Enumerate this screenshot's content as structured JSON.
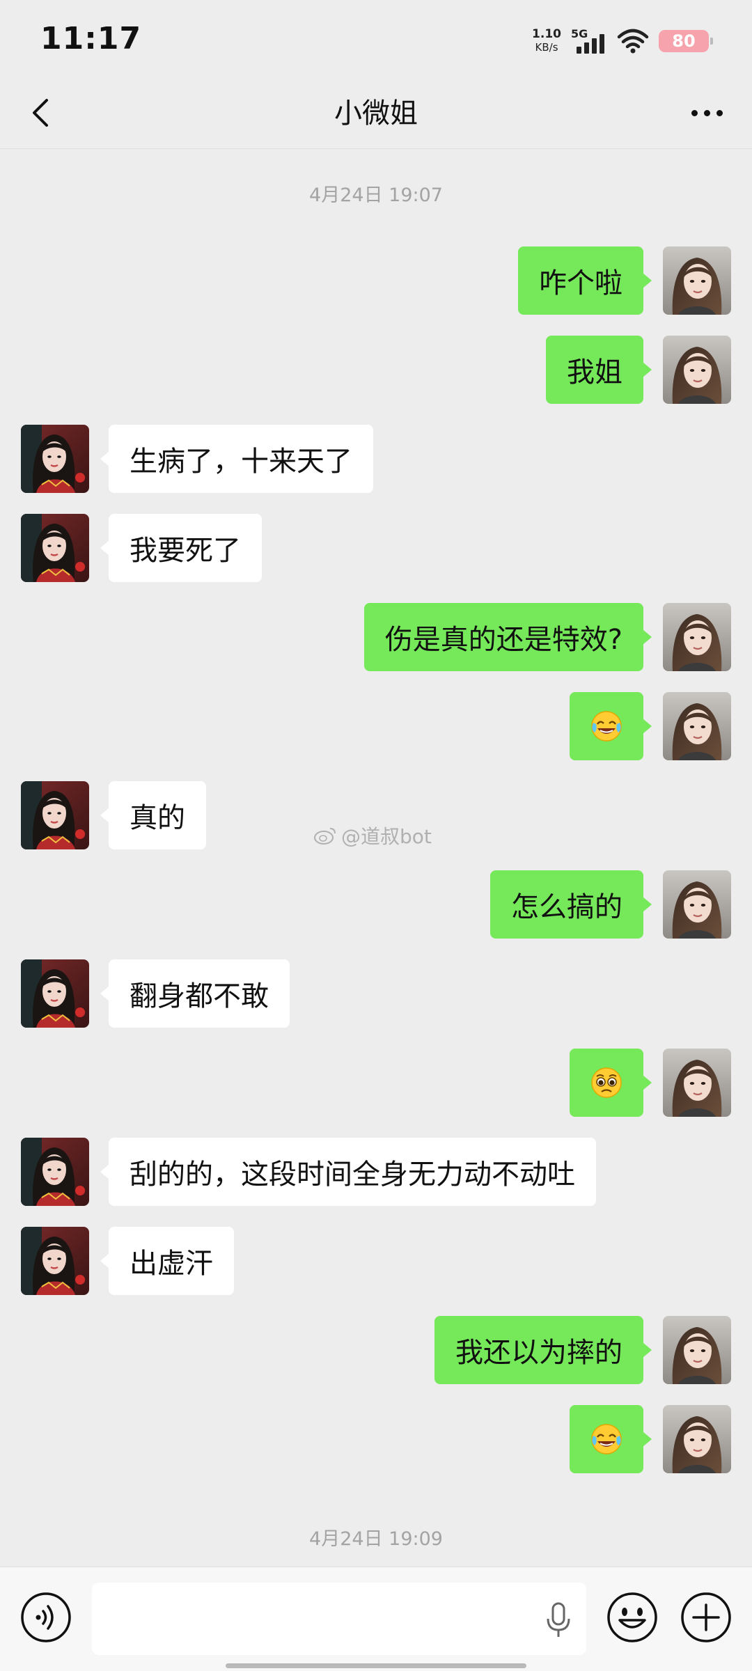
{
  "status_bar": {
    "time": "11:17",
    "net_speed_value": "1.10",
    "net_speed_unit": "KB/s",
    "network": "5G",
    "battery": "80"
  },
  "nav": {
    "title": "小微姐",
    "back_icon": "chevron-left-icon",
    "more_icon": "more-dots-icon"
  },
  "chat": {
    "timestamp_top": "4月24日 19:07",
    "timestamp_bottom": "4月24日 19:09",
    "messages": [
      {
        "from": "me",
        "text": "咋个啦"
      },
      {
        "from": "me",
        "text": "我姐"
      },
      {
        "from": "other",
        "text": "生病了，十来天了"
      },
      {
        "from": "other",
        "text": "我要死了"
      },
      {
        "from": "me",
        "text": "伤是真的还是特效?"
      },
      {
        "from": "me",
        "emoji": "laugh-cry-emoji"
      },
      {
        "from": "other",
        "text": "真的"
      },
      {
        "from": "me",
        "text": "怎么搞的"
      },
      {
        "from": "other",
        "text": "翻身都不敢"
      },
      {
        "from": "me",
        "emoji": "pleading-emoji"
      },
      {
        "from": "other",
        "text": "刮的的，这段时间全身无力动不动吐"
      },
      {
        "from": "other",
        "text": "出虚汗"
      },
      {
        "from": "me",
        "text": "我还以为摔的"
      },
      {
        "from": "me",
        "emoji": "laugh-cry-emoji"
      }
    ],
    "watermark": "@道叔bot"
  },
  "input_bar": {
    "voice_icon": "voice-icon",
    "mic_icon": "mic-icon",
    "emoji_icon": "smiley-icon",
    "plus_icon": "plus-icon"
  },
  "colors": {
    "background": "#ededed",
    "me_bubble": "#76e95a",
    "other_bubble": "#ffffff",
    "timestamp": "#a3a3a3"
  }
}
